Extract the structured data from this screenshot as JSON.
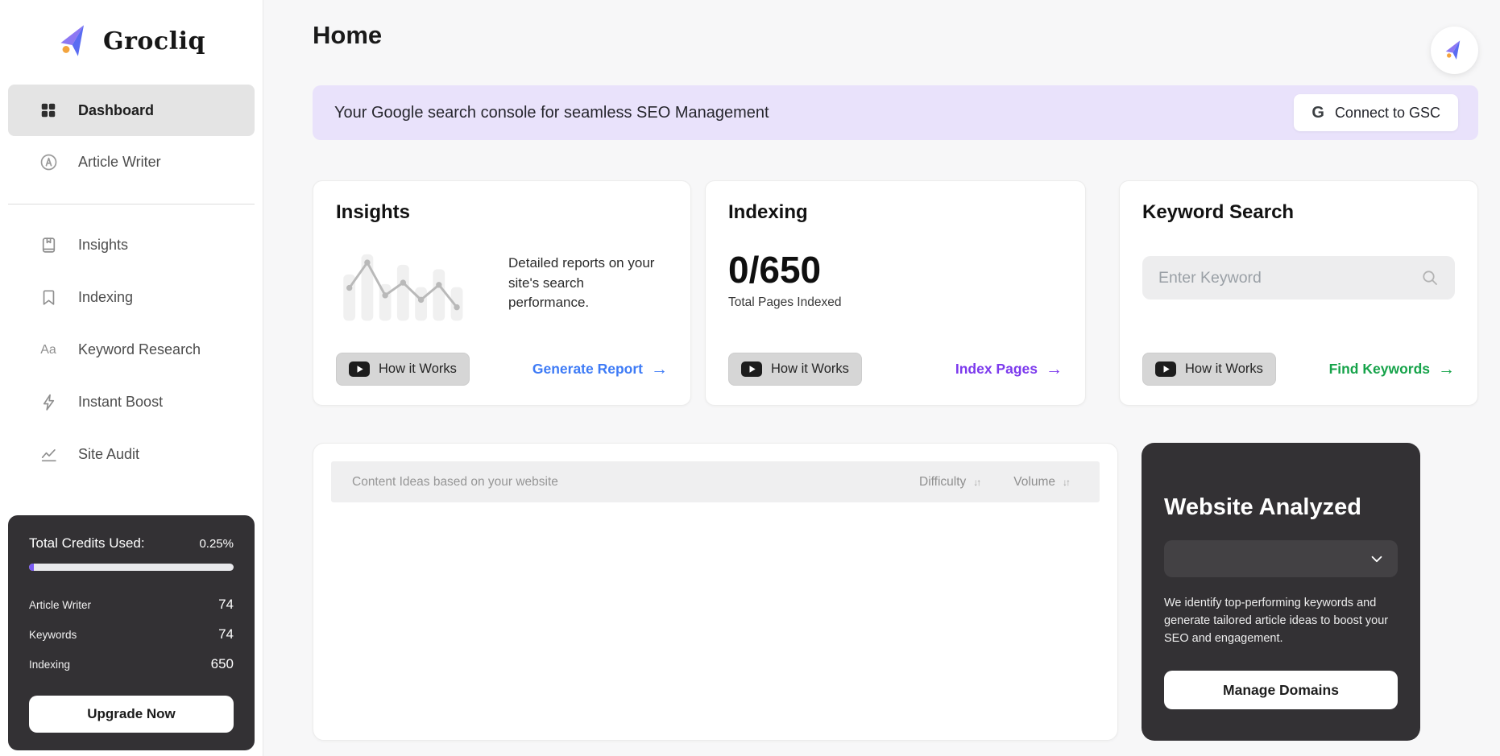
{
  "brand": {
    "name": "Grocliq"
  },
  "header": {
    "title": "Home"
  },
  "banner": {
    "text": "Your Google search console for seamless SEO Management",
    "google_g": "G",
    "button_label": "Connect to GSC"
  },
  "sidebar": {
    "nav_top": [
      {
        "label": "Dashboard",
        "icon": "grid-icon",
        "active": true
      },
      {
        "label": "Article Writer",
        "icon": "pen-circle-icon",
        "active": false
      }
    ],
    "nav_tools": [
      {
        "label": "Insights",
        "icon": "book-icon"
      },
      {
        "label": "Indexing",
        "icon": "bookmark-icon"
      },
      {
        "label": "Keyword Research",
        "icon": "letters-aa-icon"
      },
      {
        "label": "Instant Boost",
        "icon": "lightning-icon"
      },
      {
        "label": "Site Audit",
        "icon": "line-chart-icon"
      }
    ],
    "credits": {
      "title": "Total Credits Used:",
      "percent": "0.25%",
      "rows": [
        {
          "label": "Article Writer",
          "value": "74"
        },
        {
          "label": "Keywords",
          "value": "74"
        },
        {
          "label": "Indexing",
          "value": "650"
        }
      ],
      "upgrade_label": "Upgrade Now"
    }
  },
  "cards": {
    "insights": {
      "title": "Insights",
      "description": "Detailed reports on your site's search performance.",
      "how_it_works": "How it Works",
      "action": "Generate Report"
    },
    "indexing": {
      "title": "Indexing",
      "stat": "0/650",
      "caption": "Total Pages Indexed",
      "how_it_works": "How it Works",
      "action": "Index Pages"
    },
    "keyword": {
      "title": "Keyword Search",
      "placeholder": "Enter Keyword",
      "how_it_works": "How it Works",
      "action": "Find Keywords"
    }
  },
  "content_ideas": {
    "header": "Content Ideas based on your website",
    "columns": [
      "Difficulty",
      "Volume"
    ]
  },
  "website_analyzed": {
    "title": "Website Analyzed",
    "dropdown_value": "",
    "description": "We identify top-performing keywords and generate tailored article ideas to boost your SEO and engagement.",
    "button_label": "Manage Domains"
  },
  "icons": {
    "sort": "↓↑",
    "arrow_right": "→"
  },
  "colors": {
    "banner_bg": "#e9e2fb",
    "sidebar_active_bg": "#e4e4e4",
    "dark_card_bg": "#333134",
    "progress_fill": "#7a5af5",
    "link_blue": "#3e7bf6",
    "link_purple": "#7c3aed",
    "link_green": "#16a34a",
    "brand_purple": "#8d78f3",
    "brand_blue": "#5a6cf2",
    "brand_orange": "#f3a43d"
  }
}
